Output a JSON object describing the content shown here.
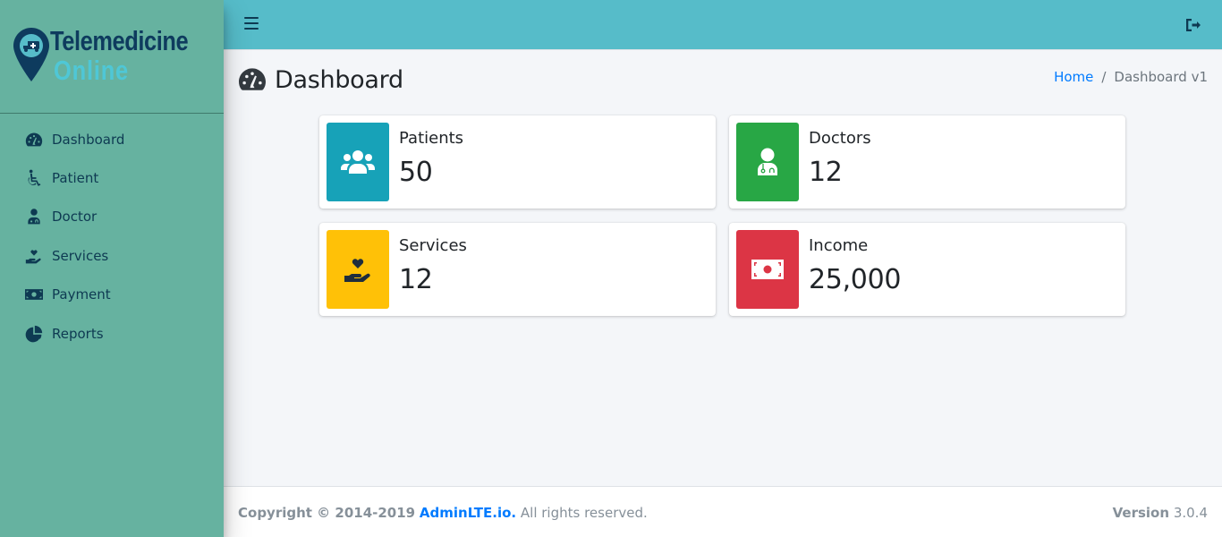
{
  "brand": {
    "line1": "Telemedicine",
    "line2": "Online",
    "logo_icon": "map-pin-ambulance-icon"
  },
  "sidebar": {
    "items": [
      {
        "label": "Dashboard",
        "icon": "tachometer-icon"
      },
      {
        "label": "Patient",
        "icon": "wheelchair-icon"
      },
      {
        "label": "Doctor",
        "icon": "user-doctor-icon"
      },
      {
        "label": "Services",
        "icon": "hand-holding-heart-icon"
      },
      {
        "label": "Payment",
        "icon": "money-bill-icon"
      },
      {
        "label": "Reports",
        "icon": "chart-pie-icon"
      }
    ]
  },
  "topbar": {
    "menu_icon": "bars-icon",
    "logout_icon": "sign-out-icon"
  },
  "header": {
    "title": "Dashboard",
    "title_icon": "tachometer-icon",
    "breadcrumb": [
      {
        "label": "Home",
        "link": true
      },
      {
        "label": "Dashboard v1",
        "link": false
      }
    ],
    "breadcrumb_separator": "/"
  },
  "info_boxes": [
    {
      "label": "Patients",
      "value": "50",
      "icon": "users-icon",
      "color": "#17a2b8"
    },
    {
      "label": "Doctors",
      "value": "12",
      "icon": "user-doctor-icon",
      "color": "#28a745"
    },
    {
      "label": "Services",
      "value": "12",
      "icon": "hand-holding-heart-icon",
      "color": "#ffc107"
    },
    {
      "label": "Income",
      "value": "25,000",
      "icon": "money-bill-icon",
      "color": "#dc3545"
    }
  ],
  "footer": {
    "copyright_prefix": "Copyright © 2014-2019",
    "brand_link": "AdminLTE.io.",
    "suffix": "All rights reserved.",
    "version_label": "Version",
    "version_value": "3.0.4"
  },
  "colors": {
    "sidebar_bg": "#66b2a0",
    "topbar_bg": "#56bcc9",
    "content_bg": "#f4f6f9",
    "nav_text": "#0e3a52",
    "link": "#007bff"
  }
}
